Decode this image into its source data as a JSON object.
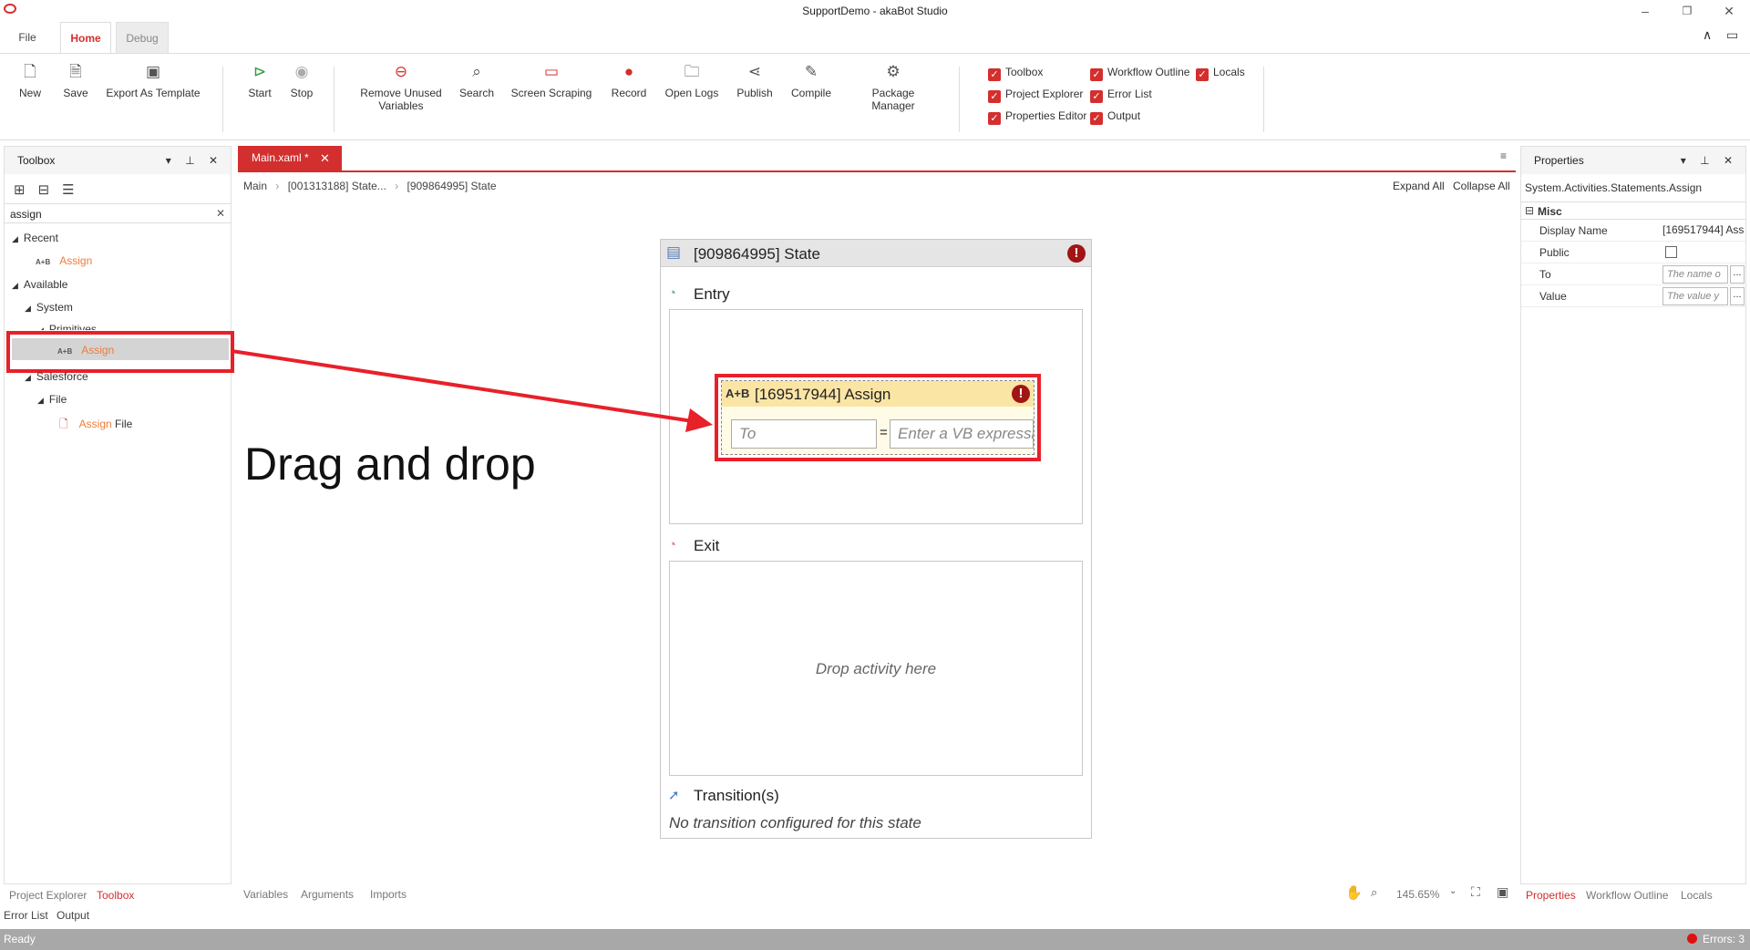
{
  "window": {
    "title": "SupportDemo - akaBot Studio",
    "minimize": "–",
    "restore": "❐",
    "close": "✕"
  },
  "ribbon_tabs": {
    "file": "File",
    "home": "Home",
    "debug": "Debug"
  },
  "ribbon_buttons": {
    "new": "New",
    "save": "Save",
    "export_template": "Export As Template",
    "start": "Start",
    "stop": "Stop",
    "remove_unused_1": "Remove Unused",
    "remove_unused_2": "Variables",
    "search": "Search",
    "screen_scraping": "Screen Scraping",
    "record": "Record",
    "open_logs": "Open Logs",
    "publish": "Publish",
    "compile": "Compile",
    "package_manager": "Package Manager"
  },
  "ribbon_panes": {
    "toolbox": "Toolbox",
    "project_explorer": "Project Explorer",
    "properties_editor": "Properties Editor",
    "workflow_outline": "Workflow Outline",
    "error_list": "Error List",
    "output": "Output",
    "locals": "Locals",
    "all_checked": true
  },
  "toolbox": {
    "title": "Toolbox",
    "search_value": "assign",
    "tree": {
      "recent": "Recent",
      "recent_assign": "Assign",
      "available": "Available",
      "system": "System",
      "primitives": "Primitives",
      "primitives_assign": "Assign",
      "salesforce": "Salesforce",
      "file": "File",
      "assign_file_a": "Assign",
      "assign_file_b": " File"
    }
  },
  "document": {
    "tab_label": "Main.xaml *",
    "breadcrumb": [
      "Main",
      "[001313188] State...",
      "[909864995] State"
    ],
    "expand_all": "Expand All",
    "collapse_all": "Collapse All"
  },
  "designer": {
    "state_title": "[909864995] State",
    "entry": "Entry",
    "exit": "Exit",
    "drop_hint": "Drop activity here",
    "transitions": "Transition(s)",
    "no_transition": "No transition configured for this state",
    "assign_title": "[169517944] Assign",
    "assign_to_placeholder": "To",
    "assign_value_placeholder": "Enter a VB expressi",
    "equals": "="
  },
  "annotation": {
    "text": "Drag and drop",
    "color": "#e8202a"
  },
  "properties": {
    "title": "Properties",
    "type": "System.Activities.Statements.Assign",
    "category": "Misc",
    "rows": [
      {
        "key": "Display Name",
        "value": "[169517944] Assi"
      },
      {
        "key": "Public",
        "value": ""
      },
      {
        "key": "To",
        "value": "The name o"
      },
      {
        "key": "Value",
        "value": "The value y"
      }
    ],
    "dots": "..."
  },
  "bottom_tabs_left": [
    "Project Explorer",
    "Toolbox",
    "Error List",
    "Output"
  ],
  "bottom_tabs_center": [
    "Variables",
    "Arguments",
    "Imports"
  ],
  "zoom": "145.65%",
  "bottom_tabs_right": [
    "Properties",
    "Workflow Outline",
    "Locals"
  ],
  "status": {
    "text": "Ready",
    "errors": "Errors: 3"
  },
  "colors": {
    "accent": "#d32f2f",
    "orange": "#ef7b3a",
    "error": "#a11515"
  }
}
